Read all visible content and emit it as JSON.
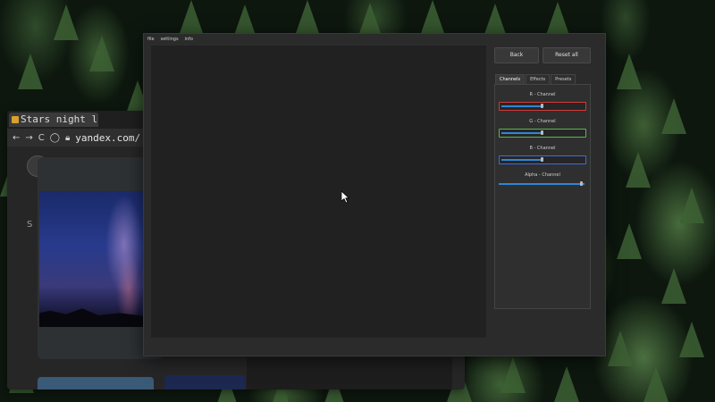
{
  "app": {
    "menu": [
      "file",
      "settings",
      "info"
    ],
    "buttons": {
      "back": "Back",
      "reset_all": "Reset all"
    },
    "tabs": [
      "Channels",
      "Effects",
      "Presets"
    ],
    "active_tab": "Channels",
    "channels": [
      {
        "label": "R - Channel",
        "border_color": "#d23a3a",
        "value": 0.5
      },
      {
        "label": "G - Channel",
        "border_color": "#58b84a",
        "value": 0.5
      },
      {
        "label": "B - Channel",
        "border_color": "#3a6ee0",
        "value": 0.5
      },
      {
        "label": "Alpha - Channel",
        "border_color": "none",
        "value": 1.0
      }
    ]
  },
  "browser": {
    "tab_title": "Stars night l",
    "url": "yandex.com/",
    "sidebar_char": "S"
  },
  "colors": {
    "accent": "#2f86d8",
    "panel_bg": "#2b2b2b",
    "canvas_bg": "#212121"
  }
}
